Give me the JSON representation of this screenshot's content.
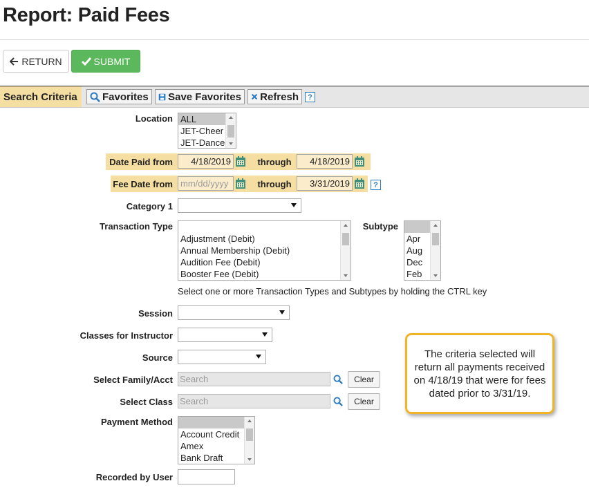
{
  "page": {
    "title": "Report: Paid Fees"
  },
  "actions": {
    "return_label": "RETURN",
    "submit_label": "SUBMIT"
  },
  "criteria_bar": {
    "label": "Search Criteria",
    "favorites_label": "Favorites",
    "save_favorites_label": "Save Favorites",
    "refresh_label": "Refresh",
    "help_glyph": "?"
  },
  "form": {
    "location": {
      "label": "Location",
      "options": [
        "ALL",
        "JET-Cheer",
        "JET-Dance"
      ],
      "selected": "ALL"
    },
    "date_paid": {
      "label": "Date Paid from",
      "from": "4/18/2019",
      "through_label": "through",
      "to": "4/18/2019"
    },
    "fee_date": {
      "label": "Fee Date from",
      "from_placeholder": "mm/dd/yyyy",
      "through_label": "through",
      "to": "3/31/2019",
      "help_glyph": "?"
    },
    "category1": {
      "label": "Category 1",
      "value": ""
    },
    "transaction_type": {
      "label": "Transaction Type",
      "options": [
        "",
        "Adjustment (Debit)",
        "Annual Membership (Debit)",
        "Audition Fee (Debit)",
        "Booster Fee (Debit)"
      ]
    },
    "subtype": {
      "label": "Subtype",
      "options": [
        "",
        "Apr",
        "Aug",
        "Dec",
        "Feb"
      ]
    },
    "ctrl_hint": "Select one or more Transaction Types and Subtypes by holding the CTRL key",
    "session": {
      "label": "Session",
      "value": ""
    },
    "classes_for_instructor": {
      "label": "Classes for Instructor",
      "value": ""
    },
    "source": {
      "label": "Source",
      "value": ""
    },
    "select_family": {
      "label": "Select Family/Acct",
      "placeholder": "Search",
      "clear_label": "Clear"
    },
    "select_class": {
      "label": "Select Class",
      "placeholder": "Search",
      "clear_label": "Clear"
    },
    "payment_method": {
      "label": "Payment Method",
      "options": [
        "",
        "Account Credit",
        "Amex",
        "Bank Draft"
      ]
    },
    "recorded_by_user": {
      "label": "Recorded by User",
      "value": ""
    }
  },
  "callout": {
    "text": "The criteria selected will return all payments received on 4/18/19 that were for fees dated prior to 3/31/19."
  },
  "colors": {
    "submit_green": "#5cb85c",
    "criteria_highlight": "#f5dea2",
    "callout_border": "#f0b429",
    "link_blue": "#2b7bc2",
    "calendar_green": "#3f8f7a"
  }
}
